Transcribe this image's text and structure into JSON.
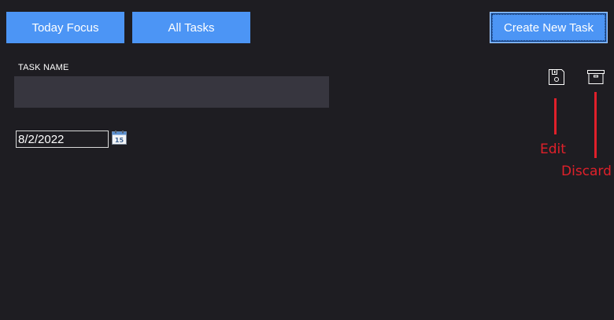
{
  "nav": {
    "today_label": "Today Focus",
    "all_label": "All Tasks",
    "create_label": "Create New Task"
  },
  "form": {
    "task_name_label": "TASK NAME",
    "task_name_value": "",
    "date_value": "8/2/2022",
    "calendar_day": "15"
  },
  "actions": {
    "save_icon": "floppy-disk-icon",
    "archive_icon": "archive-box-icon"
  },
  "annotations": {
    "edit_label": "Edit",
    "discard_label": "Discard"
  },
  "colors": {
    "background": "#1e1d22",
    "button": "#4c95f5",
    "input": "#37363f",
    "annotation": "#e0202a"
  }
}
